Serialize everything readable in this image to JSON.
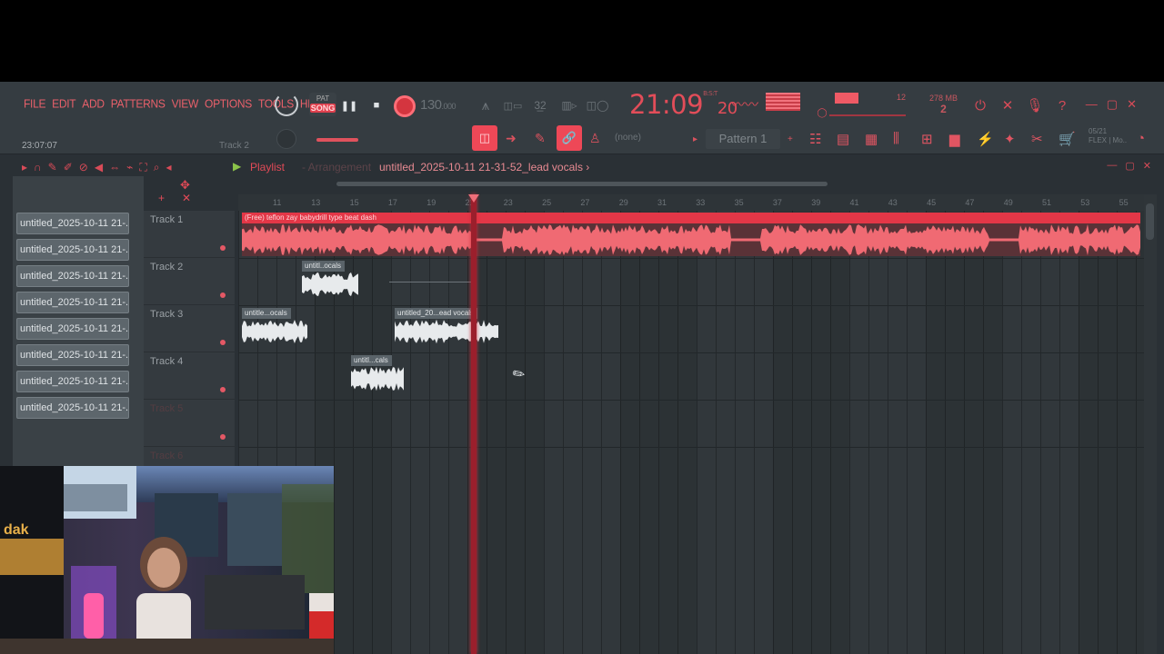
{
  "menu": [
    "FILE",
    "EDIT",
    "ADD",
    "PATTERNS",
    "VIEW",
    "OPTIONS",
    "TOOLS",
    "HELP"
  ],
  "transport": {
    "pat_label": "PAT",
    "song_label": "SONG",
    "tempo": "130",
    "tempo_decimal": ".000",
    "time_main": "21:09",
    "time_sub": "20",
    "time_sup": "B:S:T",
    "memory_top": "12",
    "memory_mb": "278 MB",
    "memory_bottom": "2"
  },
  "hint_bar": {
    "clock": "23:07:07",
    "target": "Track 2"
  },
  "toolbar": {
    "none_label": "(none)",
    "pattern": "Pattern 1",
    "flex_info_1": "05/21",
    "flex_info_2": "FLEX | Mo.."
  },
  "playlist": {
    "title": "Playlist",
    "subtitle": "- Arrangement",
    "file": "untitled_2025-10-11 21-31-52_lead vocals",
    "file_arrow": "›"
  },
  "browser_items": [
    "untitled_2025-10-11 21-...",
    "untitled_2025-10-11 21-...",
    "untitled_2025-10-11 21-...",
    "untitled_2025-10-11 21-...",
    "untitled_2025-10-11 21-...",
    "untitled_2025-10-11 21-...",
    "untitled_2025-10-11 21-...",
    "untitled_2025-10-11 21-..."
  ],
  "tracks": [
    "Track 1",
    "Track 2",
    "Track 3",
    "Track 4",
    "Track 5",
    "Track 6"
  ],
  "bar_numbers": [
    "11",
    "13",
    "15",
    "17",
    "19",
    "21",
    "23",
    "25",
    "27",
    "29",
    "31",
    "33",
    "35",
    "37",
    "39",
    "41",
    "43",
    "45",
    "47",
    "49",
    "51",
    "53",
    "55"
  ],
  "clips": {
    "beat": "(Free) teflon zay  babydrill type beat dash",
    "t2": "untitl..ocals",
    "t3a": "untitle...ocals",
    "t3b": "untitled_20...ead vocals",
    "t4": "untitl...cals"
  },
  "colors": {
    "accent": "#e33747",
    "waveform": "#f06a73",
    "playhead": "#9b1f2c"
  }
}
